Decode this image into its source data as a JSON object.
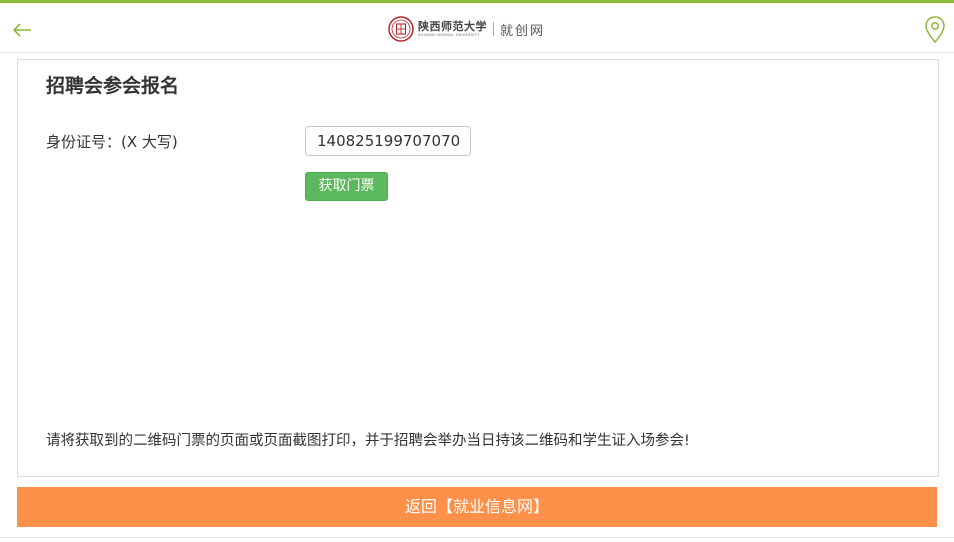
{
  "header": {
    "university_name": "陕西师范大学",
    "university_en": "SHAANXI NORMAL UNIVERSITY",
    "site_name": "就创网",
    "back_icon": "arrow-left-icon",
    "location_icon": "location-pin-icon",
    "accent_color": "#8ab93a"
  },
  "form": {
    "title": "招聘会参会报名",
    "id_label": "身份证号：(X 大写)",
    "id_value": "140825199707070",
    "get_ticket_label": "获取门票",
    "notice": "请将获取到的二维码门票的页面或页面截图打印，并于招聘会举办当日持该二维码和学生证入场参会!"
  },
  "footer": {
    "return_label": "返回【就业信息网】",
    "return_color": "#ff904a"
  }
}
